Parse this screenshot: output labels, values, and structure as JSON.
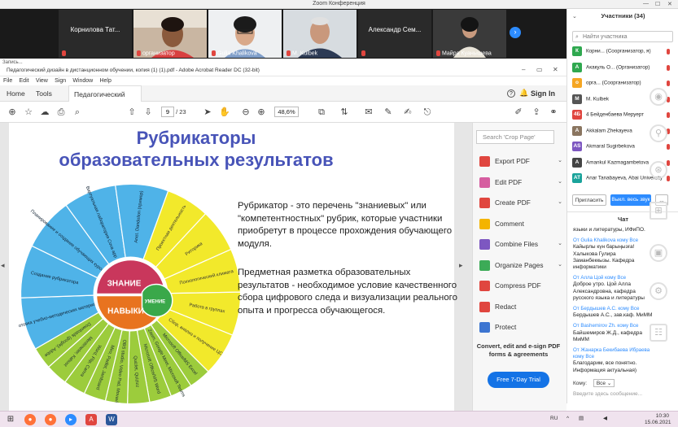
{
  "zoom": {
    "window_title": "Zoom Конференция",
    "window_controls": [
      "—",
      "☐",
      "✕"
    ],
    "tiles": [
      {
        "name": "Корнилова Тат...",
        "type": "name"
      },
      {
        "name": "организатор",
        "type": "video"
      },
      {
        "name": "Gulia Khalikova",
        "type": "video"
      },
      {
        "name": "M. Kulbek",
        "type": "video"
      },
      {
        "name": "Александр Сем...",
        "type": "name"
      },
      {
        "name": "Майра Куанышева",
        "type": "video"
      }
    ],
    "next_label": "›"
  },
  "acrobat": {
    "recording_label": "Запись...",
    "window_title": "Педагогический дизайн в дистанционном обучении, копия (1) (1).pdf - Adobe Acrobat Reader DC (32-bit)",
    "menu": [
      "File",
      "Edit",
      "View",
      "Sign",
      "Window",
      "Help"
    ],
    "tabs": {
      "home": "Home",
      "tools": "Tools",
      "doc": "Педагогический ди...",
      "close": "×"
    },
    "help": "?",
    "sign_in": "Sign In",
    "page_current": "9",
    "page_total": "/ 23",
    "zoom_value": "48,6%"
  },
  "document": {
    "title_line1": "Рубрикаторы",
    "title_line2": "образовательных результатов",
    "paragraph1": "Рубрикатор - это перечень \"знаниевых\" или \"компетентностных\" рубрик, которые участники приобретут в процессе прохождения обучающего модуля.",
    "paragraph2": "Предметная разметка образовательных результатов - необходимое условие качественного сбора цифрового следа и визуализации реального опыта и прогресса обучающегося.",
    "wheel": {
      "center_top": "ЗНАНИЕ",
      "center_right": "УМЕНИЕ",
      "center_bottom": "НАВЫКИ",
      "blue_segments": [
        "Подготовка учебно-методических материалов",
        "Создание рубрикатора",
        "Планирование и создание обучающих курсов ДО",
        "Виртуальная лаборатория Cova app",
        "Anet. Dandelion (пример)"
      ],
      "yellow_segments": [
        "Проектная деятельность",
        "Риторика",
        "Психологический климата",
        "Работа в группах",
        "Сбор, анализ и получение ЦС"
      ],
      "green_segments": [
        "Microsoft Office/MS Excel",
        "Zoom, Google Meet, Microsoft Teams",
        "Microsoft Office/MS Word",
        "Quizlet, Quizizz",
        "OBS studio, Video Pad, Movavi",
        "Miro, Padlet, Jamboard",
        "Word, Flip, Canva",
        "Mentimeter, Kahoot",
        "Downloads (google), Adobe"
      ]
    }
  },
  "tools_pane": {
    "search_placeholder": "Search 'Crop Page'",
    "items": [
      {
        "label": "Export PDF",
        "color": "#e0463f",
        "chevron": true
      },
      {
        "label": "Edit PDF",
        "color": "#d65da0",
        "chevron": true
      },
      {
        "label": "Create PDF",
        "color": "#e0463f",
        "chevron": true
      },
      {
        "label": "Comment",
        "color": "#f4b400",
        "chevron": false
      },
      {
        "label": "Combine Files",
        "color": "#7d57c1",
        "chevron": true
      },
      {
        "label": "Organize Pages",
        "color": "#3cab57",
        "chevron": true
      },
      {
        "label": "Compress PDF",
        "color": "#e0463f",
        "chevron": false
      },
      {
        "label": "Redact",
        "color": "#e0463f",
        "chevron": false
      },
      {
        "label": "Protect",
        "color": "#3d75d1",
        "chevron": false
      }
    ],
    "promo": "Convert, edit and e-sign PDF forms & agreements",
    "trial_button": "Free 7-Day Trial"
  },
  "participants": {
    "header": "Участники (34)",
    "collapse": "⌄",
    "search_placeholder": "Найти участника",
    "list": [
      {
        "initial": "К",
        "color": "#2fa84f",
        "name": "Корни... (Соорганизатор, я)"
      },
      {
        "initial": "А",
        "color": "#2fa84f",
        "name": "Акакуль О... (Организатор)"
      },
      {
        "initial": "о",
        "color": "#f5a623",
        "name": "орга... (Соорганизатор)"
      },
      {
        "initial": "M",
        "color": "#555555",
        "name": "M. Kulbek"
      },
      {
        "initial": "4Б",
        "color": "#e0463f",
        "name": "4 Бейденбаева Меруерт"
      },
      {
        "initial": "A",
        "color": "#8a7560",
        "name": "Akkalam Zhekayeva"
      },
      {
        "initial": "AS",
        "color": "#7d57c1",
        "name": "Akmaral Sugirbekova"
      },
      {
        "initial": "A",
        "color": "#444444",
        "name": "Amankul Kazmagambetova"
      },
      {
        "initial": "AT",
        "color": "#1aa39b",
        "name": "Anar Tanabayeva, Abai University"
      }
    ],
    "invite_button": "Пригласить",
    "mute_all_button": "Выкл. весь звук",
    "more": "..."
  },
  "chat": {
    "header": "Чат",
    "messages": [
      {
        "from": "",
        "text": "языки и литературы, ИФиПО."
      },
      {
        "from": "От Gulia Khalikova кому Все",
        "text": "Кайырлы күн барыңызға! Халыкова Гулира Заманбеккызы. Кафедра информатики"
      },
      {
        "from": "От Алла Цой кому Все",
        "text": "Доброе утро. Цой Алла Александровна, кафедра русского языка и литературы"
      },
      {
        "from": "От Бердышев А.С. кому Все",
        "text": "Бердышев А.С., зав.каф. МиММ"
      },
      {
        "from": "От Bashemirov Zh. кому Все",
        "text": "Байшемиров Ж.Д., кафедра МиММ"
      },
      {
        "from": "От Жанарка Бекибаева Ибраева кому Все",
        "text": "Благодарим, все понятно. Информация актуальная)"
      }
    ],
    "to_label": "Кому:",
    "to_value": "Все",
    "input_placeholder": "Введите здесь сообщение..."
  },
  "taskbar": {
    "lang": "RU",
    "time": "10:30",
    "date": "15.06.2021"
  }
}
